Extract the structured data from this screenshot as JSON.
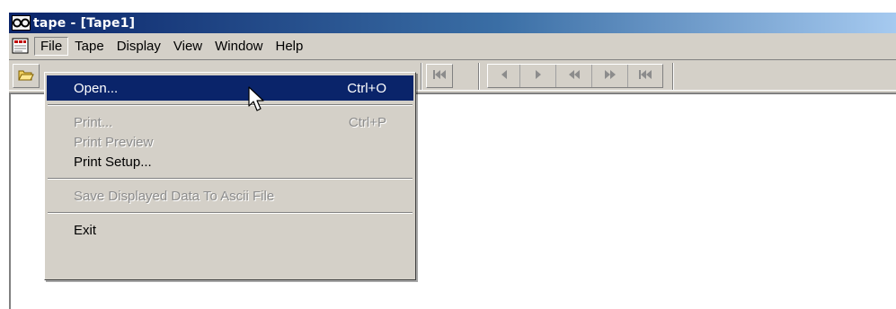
{
  "window": {
    "title": "tape - [Tape1]",
    "app_icon": "glasses-icon",
    "doc_icon": "document-icon"
  },
  "menubar": {
    "items": [
      {
        "label": "File",
        "active": true
      },
      {
        "label": "Tape"
      },
      {
        "label": "Display"
      },
      {
        "label": "View"
      },
      {
        "label": "Window"
      },
      {
        "label": "Help"
      }
    ]
  },
  "toolbar": {
    "buttons": [
      "open-folder-icon",
      "skip-to-start-icon",
      "step-back-icon",
      "play-icon",
      "rewind-icon",
      "fast-forward-icon",
      "skip-to-start-icon"
    ]
  },
  "file_menu": {
    "open": {
      "label": "Open...",
      "shortcut": "Ctrl+O"
    },
    "print": {
      "label": "Print...",
      "shortcut": "Ctrl+P"
    },
    "print_preview": {
      "label": "Print Preview"
    },
    "print_setup": {
      "label": "Print Setup..."
    },
    "save_ascii": {
      "label": "Save Displayed Data To Ascii File"
    },
    "exit": {
      "label": "Exit"
    }
  },
  "colors": {
    "highlight": "#0a246a",
    "face": "#d4d0c8",
    "disabled_text": "#8c8c8c"
  }
}
